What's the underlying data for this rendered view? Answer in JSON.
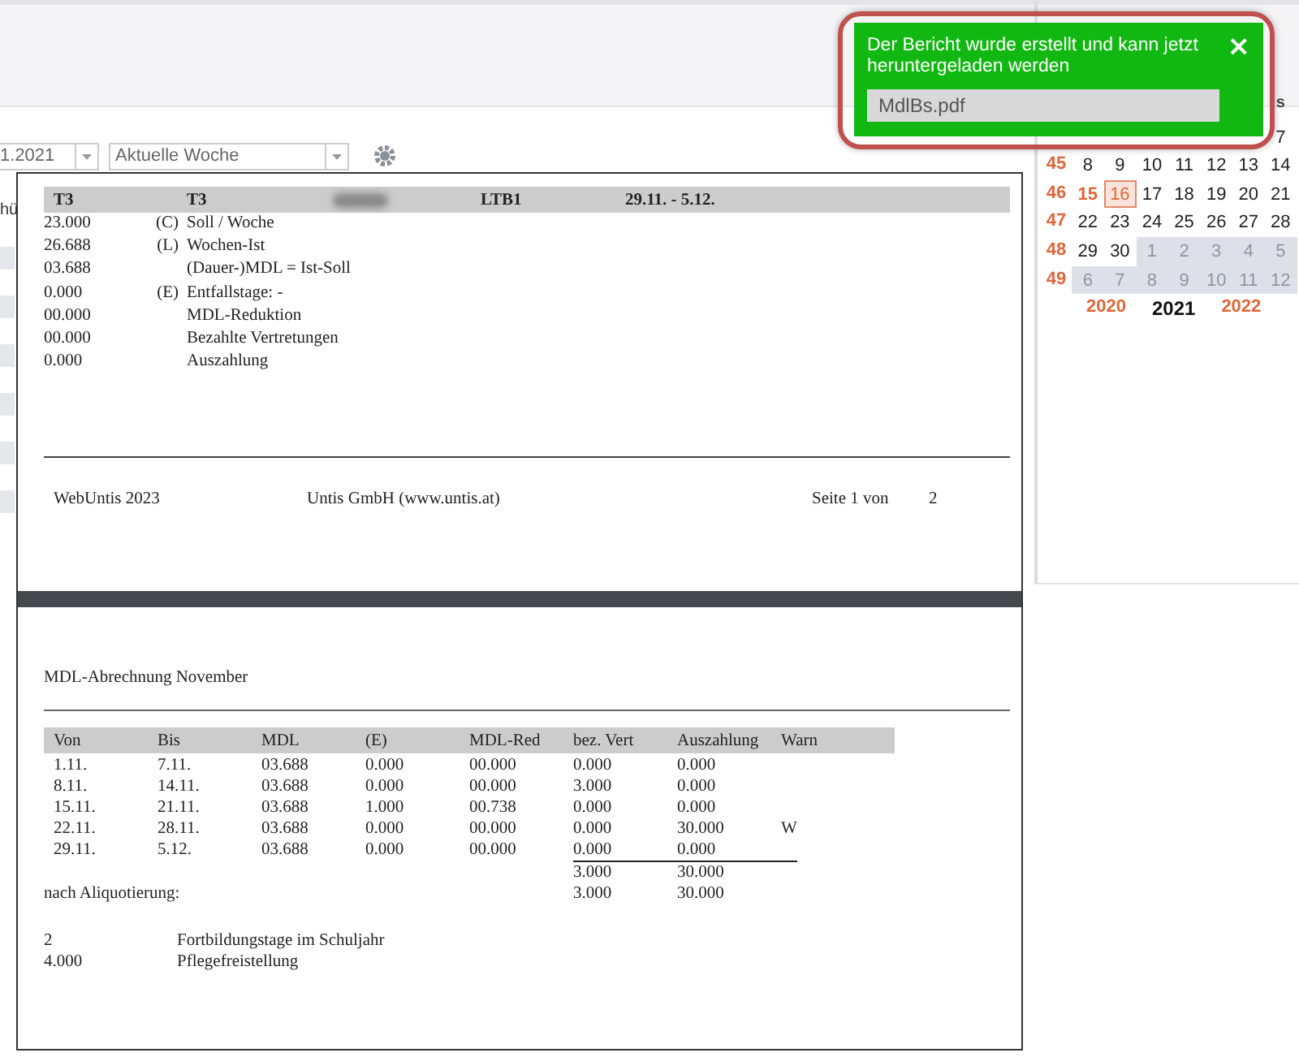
{
  "toolbar": {
    "date_value": "1.2021",
    "week_select": "Aktuelle Woche"
  },
  "background_list": {
    "header": "hü"
  },
  "calendar": {
    "header_tail": [
      "s"
    ],
    "weeks": [
      {
        "days": [
          {
            "text": "7",
            "other_month": false,
            "holiday": false,
            "selected": false
          }
        ]
      },
      {
        "week": "45",
        "days": [
          {
            "text": "8",
            "other_month": false,
            "holiday": false,
            "selected": false
          },
          {
            "text": "9",
            "other_month": false,
            "holiday": false,
            "selected": false
          },
          {
            "text": "10",
            "other_month": false,
            "holiday": false,
            "selected": false
          },
          {
            "text": "11",
            "other_month": false,
            "holiday": false,
            "selected": false
          },
          {
            "text": "12",
            "other_month": false,
            "holiday": false,
            "selected": false
          },
          {
            "text": "13",
            "other_month": false,
            "holiday": false,
            "selected": false
          },
          {
            "text": "14",
            "other_month": false,
            "holiday": false,
            "selected": false
          }
        ]
      },
      {
        "week": "46",
        "days": [
          {
            "text": "15",
            "other_month": false,
            "holiday": true,
            "selected": false
          },
          {
            "text": "16",
            "other_month": false,
            "holiday": false,
            "selected": true
          },
          {
            "text": "17",
            "other_month": false,
            "holiday": false,
            "selected": false
          },
          {
            "text": "18",
            "other_month": false,
            "holiday": false,
            "selected": false
          },
          {
            "text": "19",
            "other_month": false,
            "holiday": false,
            "selected": false
          },
          {
            "text": "20",
            "other_month": false,
            "holiday": false,
            "selected": false
          },
          {
            "text": "21",
            "other_month": false,
            "holiday": false,
            "selected": false
          }
        ]
      },
      {
        "week": "47",
        "days": [
          {
            "text": "22",
            "other_month": false,
            "holiday": false,
            "selected": false
          },
          {
            "text": "23",
            "other_month": false,
            "holiday": false,
            "selected": false
          },
          {
            "text": "24",
            "other_month": false,
            "holiday": false,
            "selected": false
          },
          {
            "text": "25",
            "other_month": false,
            "holiday": false,
            "selected": false
          },
          {
            "text": "26",
            "other_month": false,
            "holiday": false,
            "selected": false
          },
          {
            "text": "27",
            "other_month": false,
            "holiday": false,
            "selected": false
          },
          {
            "text": "28",
            "other_month": false,
            "holiday": false,
            "selected": false
          }
        ]
      },
      {
        "week": "48",
        "days": [
          {
            "text": "29",
            "other_month": false,
            "holiday": false,
            "selected": false
          },
          {
            "text": "30",
            "other_month": false,
            "holiday": false,
            "selected": false
          },
          {
            "text": "1",
            "other_month": true,
            "holiday": false,
            "selected": false
          },
          {
            "text": "2",
            "other_month": true,
            "holiday": false,
            "selected": false
          },
          {
            "text": "3",
            "other_month": true,
            "holiday": false,
            "selected": false
          },
          {
            "text": "4",
            "other_month": true,
            "holiday": false,
            "selected": false
          },
          {
            "text": "5",
            "other_month": true,
            "holiday": false,
            "selected": false
          }
        ]
      },
      {
        "week": "49",
        "days": [
          {
            "text": "6",
            "other_month": true,
            "holiday": false,
            "selected": false
          },
          {
            "text": "7",
            "other_month": true,
            "holiday": false,
            "selected": false
          },
          {
            "text": "8",
            "other_month": true,
            "holiday": false,
            "selected": false
          },
          {
            "text": "9",
            "other_month": true,
            "holiday": false,
            "selected": false
          },
          {
            "text": "10",
            "other_month": true,
            "holiday": false,
            "selected": false
          },
          {
            "text": "11",
            "other_month": true,
            "holiday": false,
            "selected": false
          },
          {
            "text": "12",
            "other_month": true,
            "holiday": false,
            "selected": false
          }
        ]
      }
    ],
    "years": [
      {
        "label": "2020",
        "selected": false
      },
      {
        "label": "2021",
        "selected": true
      },
      {
        "label": "2022",
        "selected": false
      }
    ]
  },
  "report": {
    "page1": {
      "header": [
        {
          "kind": "text",
          "text": "T3"
        },
        {
          "kind": "text",
          "text": "T3"
        },
        {
          "kind": "blurred"
        },
        {
          "kind": "text",
          "text": "LTB1"
        },
        {
          "kind": "text",
          "text": "29.11. - 5.12."
        }
      ],
      "rows": [
        {
          "value": "23.000",
          "code": "(C)",
          "label": "Soll / Woche"
        },
        {
          "value": "26.688",
          "code": "(L)",
          "label": "Wochen-Ist"
        },
        {
          "value": "03.688",
          "label": "(Dauer-)MDL = Ist-Soll"
        },
        {
          "value": "0.000",
          "code": "(E)",
          "label": "Entfallstage: -"
        },
        {
          "value": "00.000",
          "label": "MDL-Reduktion"
        },
        {
          "value": "00.000",
          "label": "Bezahlte Vertretungen"
        },
        {
          "value": "0.000",
          "label": "Auszahlung"
        }
      ],
      "footer": {
        "left": "WebUntis 2023",
        "center": "Untis GmbH (www.untis.at)",
        "page_label": "Seite 1 von",
        "page_total": "2"
      }
    },
    "page2": {
      "title": "MDL-Abrechnung November",
      "columns": [
        "Von",
        "Bis",
        "MDL",
        "(E)",
        "MDL-Red",
        "bez. Vert",
        "Auszahlung",
        "Warn"
      ],
      "rows": [
        [
          "1.11.",
          "7.11.",
          "03.688",
          "0.000",
          "00.000",
          "0.000",
          "0.000"
        ],
        [
          "8.11.",
          "14.11.",
          "03.688",
          "0.000",
          "00.000",
          "3.000",
          "0.000"
        ],
        [
          "15.11.",
          "21.11.",
          "03.688",
          "1.000",
          "00.738",
          "0.000",
          "0.000"
        ],
        [
          "22.11.",
          "28.11.",
          "03.688",
          "0.000",
          "00.000",
          "0.000",
          "30.000",
          "W"
        ],
        [
          "29.11.",
          "5.12.",
          "03.688",
          "0.000",
          "00.000",
          "0.000",
          "0.000"
        ]
      ],
      "totals": {
        "bez_vert": "3.000",
        "auszahlung": "30.000"
      },
      "aliquot": {
        "label": "nach Aliquotierung:",
        "bez_vert": "3.000",
        "auszahlung": "30.000"
      },
      "extras": [
        {
          "value": "2",
          "label": "Fortbildungstage im Schuljahr"
        },
        {
          "value": "4.000",
          "label": "Pflegefreistellung"
        }
      ]
    }
  },
  "toast": {
    "message": "Der Bericht wurde erstellt und kann jetzt heruntergeladen werden",
    "close": "×",
    "file": "MdlBs.pdf"
  }
}
